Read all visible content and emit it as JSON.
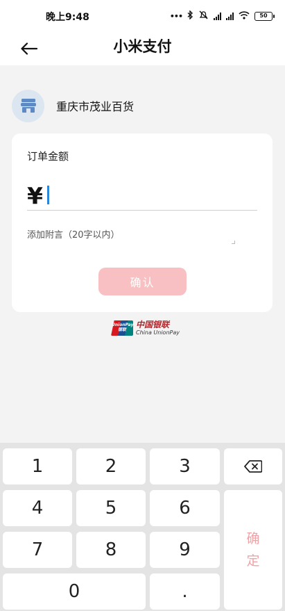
{
  "status_bar": {
    "time": "晚上9:48",
    "icons": [
      "more-dots-icon",
      "bluetooth-icon",
      "mute-icon",
      "hd-signal-icon",
      "hd-signal-icon",
      "wifi-icon",
      "battery-icon"
    ],
    "battery_level": "50"
  },
  "nav": {
    "title": "小米支付"
  },
  "merchant": {
    "name": "重庆市茂业百货"
  },
  "card": {
    "amount_label": "订单金额",
    "currency_symbol": "¥",
    "remark_placeholder": "添加附言（20字以内）",
    "confirm_label": "确认"
  },
  "unionpay": {
    "logo_text": "UnionPay 银联",
    "name_cn": "中国银联",
    "name_en": "China UnionPay"
  },
  "keypad": {
    "keys": [
      "1",
      "2",
      "3",
      "4",
      "5",
      "6",
      "7",
      "8",
      "9",
      "0",
      "."
    ],
    "confirm_line1": "确",
    "confirm_line2": "定"
  },
  "colors": {
    "accent_confirm": "#f8c0c2",
    "caret": "#2a86d6",
    "page_bg": "#f3f3f3"
  }
}
